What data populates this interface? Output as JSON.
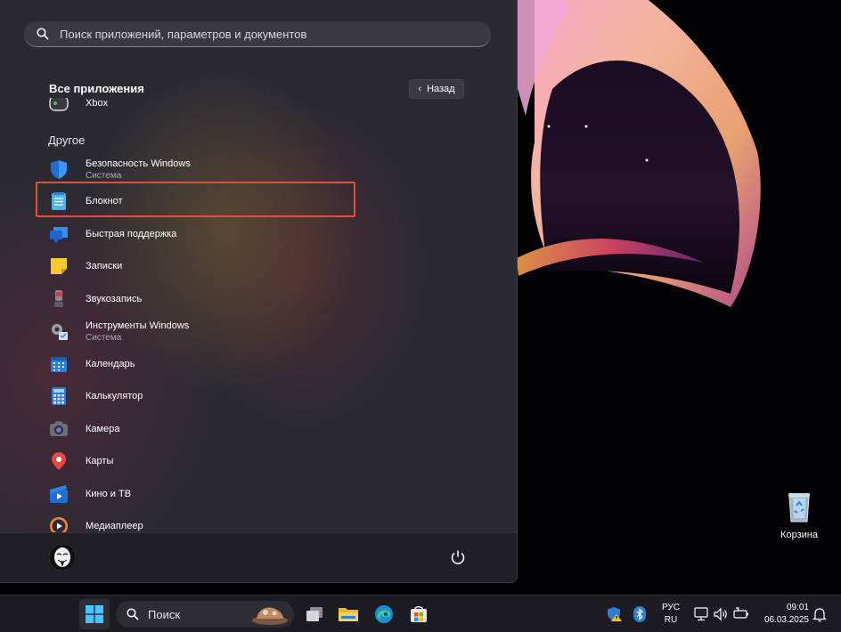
{
  "search": {
    "placeholder": "Поиск приложений, параметров и документов"
  },
  "header": {
    "title": "Все приложения",
    "back_label": "Назад"
  },
  "partial_item": "Xbox",
  "group_letter": "Другое",
  "apps": [
    {
      "name": "Безопасность Windows",
      "sub": "Система",
      "icon": "shield-icon"
    },
    {
      "name": "Блокнот",
      "sub": "",
      "icon": "notepad-icon"
    },
    {
      "name": "Быстрая поддержка",
      "sub": "",
      "icon": "quick-assist-icon"
    },
    {
      "name": "Записки",
      "sub": "",
      "icon": "sticky-notes-icon"
    },
    {
      "name": "Звукозапись",
      "sub": "",
      "icon": "microphone-icon"
    },
    {
      "name": "Инструменты Windows",
      "sub": "Система",
      "icon": "windows-tools-icon"
    },
    {
      "name": "Календарь",
      "sub": "",
      "icon": "calendar-icon"
    },
    {
      "name": "Калькулятор",
      "sub": "",
      "icon": "calculator-icon"
    },
    {
      "name": "Камера",
      "sub": "",
      "icon": "camera-icon"
    },
    {
      "name": "Карты",
      "sub": "",
      "icon": "map-pin-icon"
    },
    {
      "name": "Кино и ТВ",
      "sub": "",
      "icon": "movies-icon"
    },
    {
      "name": "Медиаплеер",
      "sub": "",
      "icon": "media-player-icon"
    }
  ],
  "desktop": {
    "recycle_bin": "Корзина"
  },
  "taskbar": {
    "search_label": "Поиск",
    "lang_top": "РУС",
    "lang_bottom": "RU",
    "time": "09:01",
    "date": "06.03.2025"
  },
  "colors": {
    "highlight": "#e04f3f",
    "accent": "#3a8ee6"
  }
}
